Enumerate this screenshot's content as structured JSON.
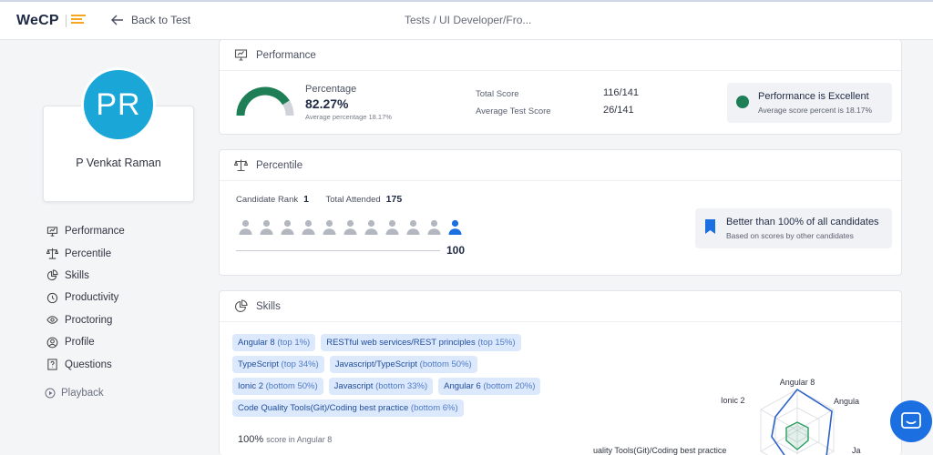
{
  "header": {
    "logo": "WeCP",
    "back_label": "Back to Test",
    "breadcrumb": "Tests / UI Developer/Fro..."
  },
  "candidate": {
    "initials": "PR",
    "name": "P Venkat Raman",
    "avatar_color": "#1aa7d8"
  },
  "nav": [
    {
      "label": "Performance",
      "icon": "presentation-chart-icon"
    },
    {
      "label": "Percentile",
      "icon": "scale-icon"
    },
    {
      "label": "Skills",
      "icon": "pie-chart-icon"
    },
    {
      "label": "Productivity",
      "icon": "clock-icon"
    },
    {
      "label": "Proctoring",
      "icon": "eye-icon"
    },
    {
      "label": "Profile",
      "icon": "user-circle-icon"
    },
    {
      "label": "Questions",
      "icon": "question-doc-icon"
    }
  ],
  "playback_label": "Playback",
  "performance": {
    "title": "Performance",
    "percentage_label": "Percentage",
    "percentage_value": "82.27%",
    "percentage_fraction": 0.8227,
    "average_line": "Average percentage 18.17%",
    "total_score_label": "Total Score",
    "total_score_value": "116/141",
    "avg_test_score_label": "Average Test Score",
    "avg_test_score_value": "26/141",
    "verdict_title": "Performance is Excellent",
    "verdict_sub": "Average score percent is 18.17%",
    "accent_color": "#1e7e55"
  },
  "percentile": {
    "title": "Percentile",
    "rank_label": "Candidate Rank",
    "rank_value": "1",
    "attended_label": "Total Attended",
    "attended_value": "175",
    "percentile_value": "100",
    "people_total": 11,
    "people_highlighted_index": 10,
    "better_title": "Better than 100% of all candidates",
    "better_sub": "Based on scores by other candidates",
    "highlight_color": "#1c6fe0"
  },
  "skills": {
    "title": "Skills",
    "tag_rows": [
      [
        {
          "name": "Angular 8",
          "rank": "(top 1%)"
        },
        {
          "name": "RESTful web services/REST principles",
          "rank": "(top 15%)"
        }
      ],
      [
        {
          "name": "TypeScript",
          "rank": "(top 34%)"
        },
        {
          "name": "Javascript/TypeScript",
          "rank": "(bottom 50%)"
        }
      ],
      [
        {
          "name": "Ionic 2",
          "rank": "(bottom 50%)"
        },
        {
          "name": "Javascript",
          "rank": "(bottom 33%)"
        },
        {
          "name": "Angular 6",
          "rank": "(bottom 20%)"
        }
      ],
      [
        {
          "name": "Code Quality Tools(Git)/Coding best practice",
          "rank": "(bottom 6%)"
        }
      ]
    ],
    "score_value": "100%",
    "score_text": "score in Angular 8",
    "radar_labels": {
      "top": "Angular 8",
      "top_right": "Angula",
      "left": "Ionic 2",
      "bottom_left": "uality Tools(Git)/Coding best practice",
      "right": "Ja"
    }
  },
  "chat_icon": "chat-icon"
}
